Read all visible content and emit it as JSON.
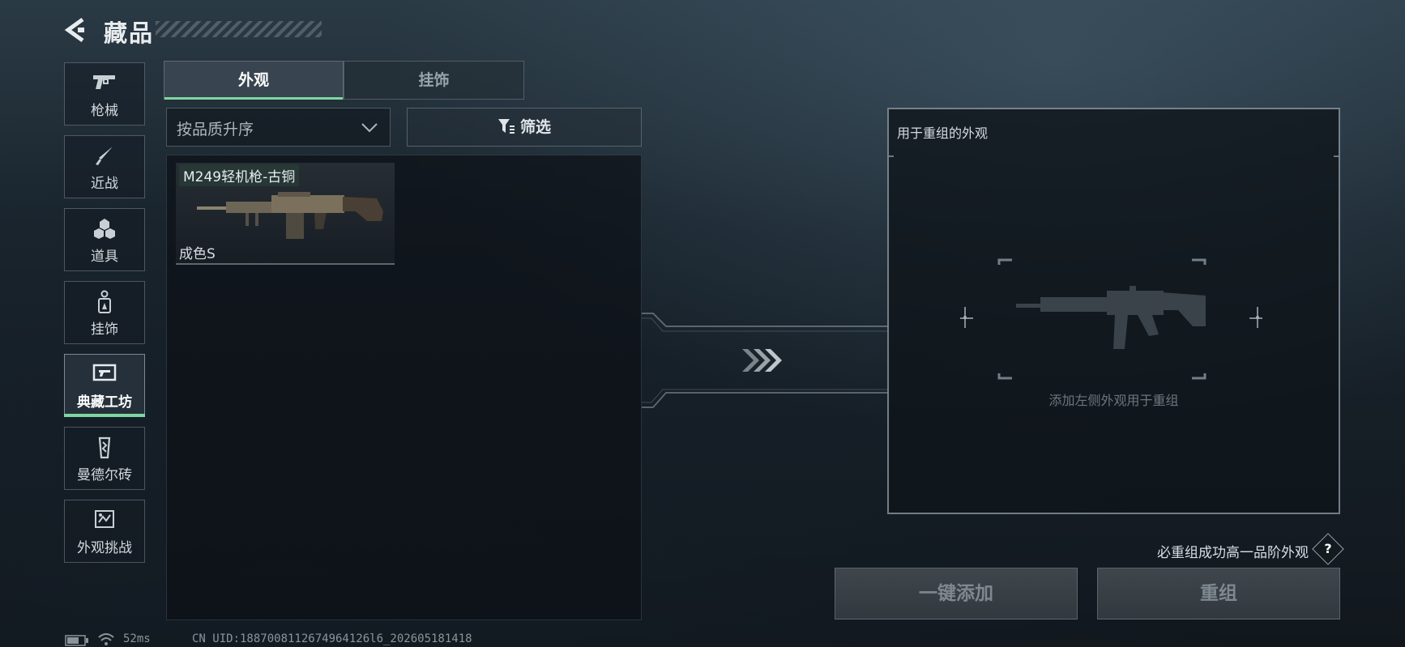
{
  "header": {
    "title": "藏品"
  },
  "sidebar": {
    "items": [
      {
        "label": "枪械",
        "icon": "pistol-icon"
      },
      {
        "label": "近战",
        "icon": "knife-icon"
      },
      {
        "label": "道具",
        "icon": "grenade-icon"
      },
      {
        "label": "挂饰",
        "icon": "charm-icon"
      },
      {
        "label": "典藏工坊",
        "icon": "workshop-icon",
        "active": true
      },
      {
        "label": "曼德尔砖",
        "icon": "brick-icon"
      },
      {
        "label": "外观挑战",
        "icon": "challenge-icon"
      }
    ]
  },
  "tabs": [
    {
      "label": "外观",
      "active": true
    },
    {
      "label": "挂饰",
      "active": false
    }
  ],
  "sort": {
    "value": "按品质升序"
  },
  "filter": {
    "label": "筛选"
  },
  "items": [
    {
      "name": "M249轻机枪-古铜",
      "grade": "成色S"
    }
  ],
  "recombine_panel": {
    "title": "用于重组的外观",
    "hint": "添加左侧外观用于重组"
  },
  "note": "必重组成功高一品阶外观",
  "help": "?",
  "buttons": {
    "add_all": "一键添加",
    "recombine": "重组"
  },
  "footer": {
    "ping": "52ms",
    "uid": "CN UID:1887008112674964126l6_202605181418"
  },
  "colors": {
    "accent": "#7ed7a1"
  }
}
